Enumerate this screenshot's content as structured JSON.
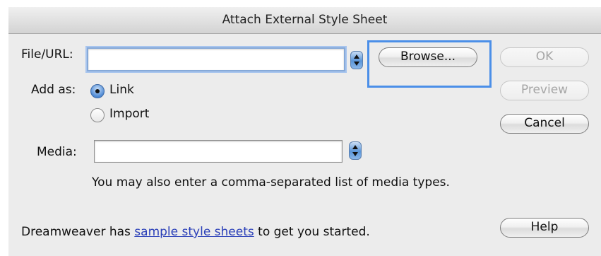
{
  "dialog": {
    "title": "Attach External Style Sheet"
  },
  "file_url": {
    "label": "File/URL:",
    "value": "",
    "browse_label": "Browse..."
  },
  "add_as": {
    "label": "Add as:",
    "options": [
      {
        "label": "Link",
        "selected": true
      },
      {
        "label": "Import",
        "selected": false
      }
    ]
  },
  "media": {
    "label": "Media:",
    "value": "",
    "hint": "You may also enter a comma-separated list of media types."
  },
  "buttons": {
    "ok": "OK",
    "preview": "Preview",
    "cancel": "Cancel",
    "help": "Help"
  },
  "footer": {
    "prefix": "Dreamweaver has ",
    "link": "sample style sheets",
    "suffix": " to get you started."
  },
  "colors": {
    "dialog_bg": "#ececec",
    "focus_ring": "#4b8fe8",
    "link": "#2a3fb8",
    "stepper": "#5a95d8"
  },
  "icons": {
    "stepper": "up-down-arrows-icon",
    "radio_selected": "radio-selected-icon",
    "radio_unselected": "radio-unselected-icon"
  }
}
